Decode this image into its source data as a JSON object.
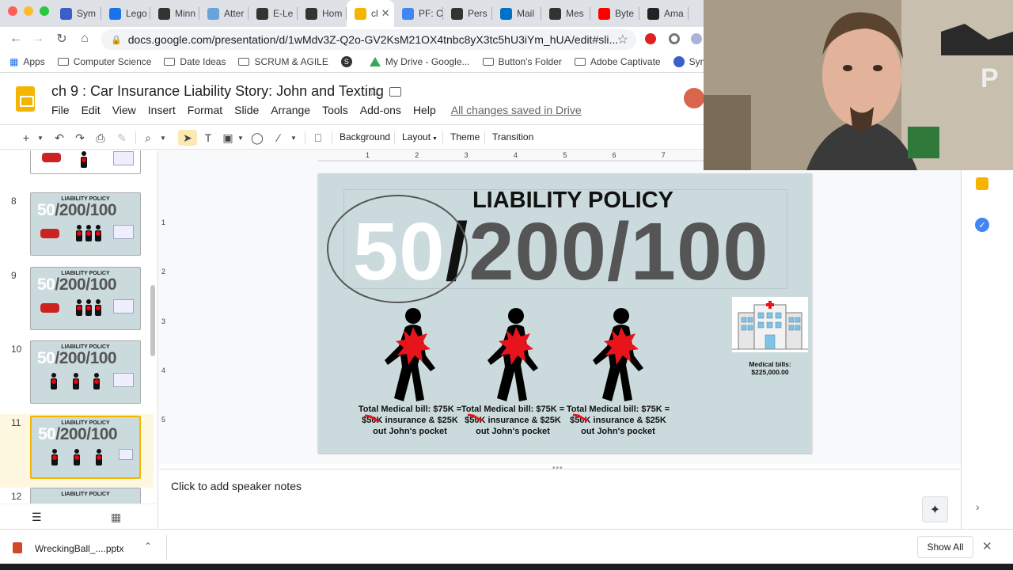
{
  "browser": {
    "tabs": [
      {
        "label": "Sym",
        "icon": "symbaloo-icon",
        "color": "#3a5fc8"
      },
      {
        "label": "Lego",
        "icon": "cloud-icon",
        "color": "#1a73e8"
      },
      {
        "label": "Minn",
        "icon": "github-icon",
        "color": "#333333"
      },
      {
        "label": "Atter",
        "icon": "attendance-icon",
        "color": "#6aa3d8"
      },
      {
        "label": "E-Le",
        "icon": "schoology-icon",
        "color": "#333333"
      },
      {
        "label": "Hom",
        "icon": "homework-icon",
        "color": "#333333"
      },
      {
        "label": "cl",
        "icon": "slides-icon",
        "color": "#f4b400",
        "active": true
      },
      {
        "label": "PF: C",
        "icon": "docs-icon",
        "color": "#4285f4"
      },
      {
        "label": "Pers",
        "icon": "schoology-icon",
        "color": "#333333"
      },
      {
        "label": "Mail",
        "icon": "outlook-icon",
        "color": "#0072c6"
      },
      {
        "label": "Mes",
        "icon": "schoology-icon",
        "color": "#333333"
      },
      {
        "label": "Byte",
        "icon": "youtube-icon",
        "color": "#ff0000"
      },
      {
        "label": "Ama",
        "icon": "amazon-icon",
        "color": "#222222"
      }
    ],
    "url": "docs.google.com/presentation/d/1wMdv3Z-Q2o-GV2KsM21OX4tnbc8yX3tc5hU3iYm_hUA/edit#sli...",
    "bookmarks": [
      {
        "label": "Apps",
        "icon": "apps-grid-icon"
      },
      {
        "label": "Computer Science",
        "icon": "folder-icon"
      },
      {
        "label": "Date Ideas",
        "icon": "folder-icon"
      },
      {
        "label": "SCRUM & AGILE",
        "icon": "folder-icon"
      },
      {
        "label": "",
        "icon": "schoology-icon"
      },
      {
        "label": "My Drive - Google...",
        "icon": "drive-icon"
      },
      {
        "label": "Button's Folder",
        "icon": "folder-icon"
      },
      {
        "label": "Adobe Captivate",
        "icon": "folder-icon"
      },
      {
        "label": "Symba",
        "icon": "symbaloo-icon"
      }
    ]
  },
  "doc": {
    "title": "ch 9 : Car Insurance Liability Story: John and Texting",
    "menu": [
      "File",
      "Edit",
      "View",
      "Insert",
      "Format",
      "Slide",
      "Arrange",
      "Tools",
      "Add-ons",
      "Help"
    ],
    "saved_status": "All changes saved in Drive"
  },
  "toolbar": {
    "background": "Background",
    "layout": "Layout",
    "theme": "Theme",
    "transition": "Transition"
  },
  "ruler": {
    "h": [
      "1",
      "2",
      "3",
      "4",
      "5",
      "6",
      "7"
    ],
    "v": [
      "1",
      "2",
      "3",
      "4",
      "5"
    ]
  },
  "filmstrip": {
    "thumbs": [
      {
        "num": "",
        "title": ""
      },
      {
        "num": "8",
        "title": "LIABILITY POLICY"
      },
      {
        "num": "9",
        "title": "LIABILITY POLICY"
      },
      {
        "num": "10",
        "title": "LIABILITY POLICY"
      },
      {
        "num": "11",
        "title": "LIABILITY POLICY",
        "active": true
      },
      {
        "num": "12",
        "title": "LIABILITY POLICY"
      }
    ],
    "big_white": "50",
    "big_rest": "/200/100"
  },
  "slide": {
    "title": "LIABILITY POLICY",
    "num_a": "50",
    "num_slash": "/",
    "num_b": "200/100",
    "captions": [
      "Total Medical bill: $75K = $50K insurance & $25K out John's pocket",
      "Total Medical bill: $75K = $50K insurance & $25K out John's pocket",
      "Total Medical bill: $75K = $50K insurance & $25K out John's pocket"
    ],
    "hospital_caption": "Medical bills: $225,000.00",
    "accent_red": "#e8141c",
    "background": "#cbdbdd"
  },
  "notes": {
    "placeholder": "Click to add speaker notes"
  },
  "download": {
    "filename": "WreckingBall_....pptx",
    "show_all": "Show All"
  }
}
